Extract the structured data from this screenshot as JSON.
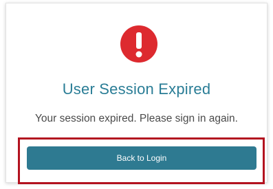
{
  "dialog": {
    "icon": "exclamation-circle-icon",
    "icon_color": "#dd2a2f",
    "title": "User Session Expired",
    "title_color": "#2a7d96",
    "message": "Your session expired. Please sign in again.",
    "button_label": "Back to Login",
    "button_color": "#2e7a91",
    "highlight_color": "#b3121f"
  }
}
